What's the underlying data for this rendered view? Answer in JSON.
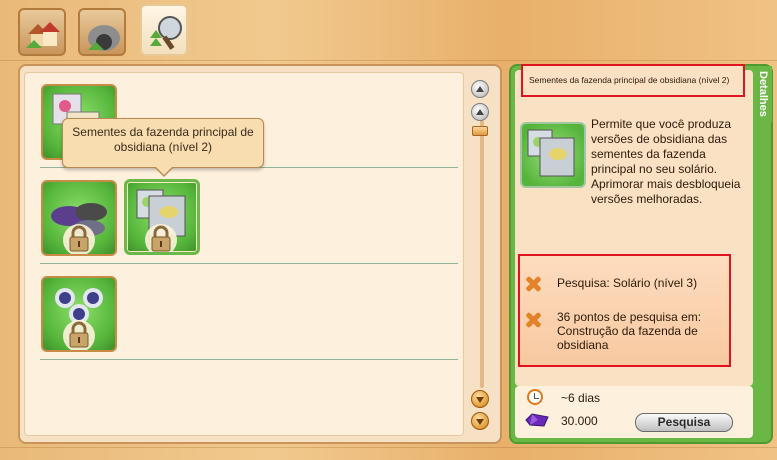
{
  "tabs": [
    {
      "name": "buildings-tab",
      "icon": "farm-buildings-icon",
      "active": false
    },
    {
      "name": "decorations-tab",
      "icon": "cave-icon",
      "active": false
    },
    {
      "name": "research-tab",
      "icon": "research-tools-icon",
      "active": true
    }
  ],
  "tooltip": {
    "text": "Sementes da fazenda principal de obsidiana (nível 2)"
  },
  "grid": {
    "rows": [
      {
        "items": [
          {
            "icon": "seed-packets-icon",
            "locked": false
          }
        ]
      },
      {
        "items": [
          {
            "icon": "obsidian-seeds-icon",
            "locked": true
          },
          {
            "icon": "seed-packets-icon",
            "locked": true,
            "selected": true
          }
        ]
      },
      {
        "items": [
          {
            "icon": "obsidian-fruit-icon",
            "locked": true
          }
        ]
      }
    ]
  },
  "details": {
    "tab_label": "Detalhes",
    "title": "Sementes da fazenda principal de obsidiana (nível 2)",
    "description": "Permite que você produza versões de obsidiana das sementes da fazenda principal no seu solário. Aprimorar mais desbloqueia versões melhoradas.",
    "requirements": [
      {
        "text": "Pesquisa: Solário (nível 3)",
        "met": false
      },
      {
        "text": "36 pontos de pesquisa em: Construção da fazenda de obsidiana",
        "met": false
      }
    ],
    "time": "~6 dias",
    "cost": "30.000",
    "research_button": "Pesquisa"
  },
  "colors": {
    "accent_green": "#6bb745",
    "highlight_red": "#e0141e",
    "wood": "#e9b978"
  }
}
